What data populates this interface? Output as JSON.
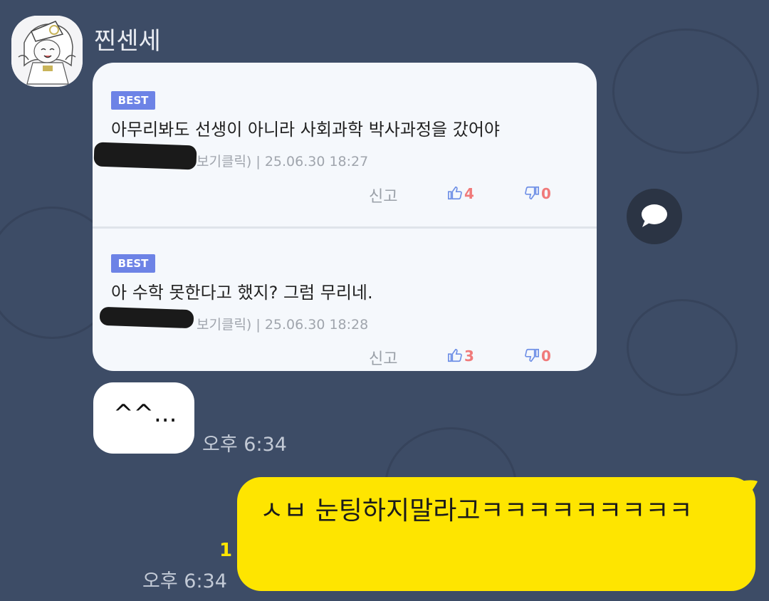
{
  "chat": {
    "sender_name": "찐센세",
    "comment_card": {
      "comments": [
        {
          "badge": "BEST",
          "text": "아무리봐도 선생이 아니라 사회과학 박사과정을 갔어야",
          "meta_visible": "보기클릭) | 25.06.30 18:27",
          "report_label": "신고",
          "likes": "4",
          "dislikes": "0"
        },
        {
          "badge": "BEST",
          "text": "아 수학 못한다고 했지? 그럼 무리네.",
          "meta_visible": "보기클릭) | 25.06.30 18:28",
          "report_label": "신고",
          "likes": "3",
          "dislikes": "0"
        }
      ]
    },
    "received_message": {
      "text": "^^...",
      "time": "오후 6:34"
    },
    "sent_message": {
      "text": "ㅅㅂ 눈팅하지말라고ㅋㅋㅋㅋㅋㅋㅋㅋㅋ",
      "time": "오후 6:34",
      "unread_count": "1"
    }
  },
  "colors": {
    "background": "#3d4c66",
    "sent_bubble": "#fee500",
    "badge": "#6d83e6",
    "vote_count": "#f07a7a"
  },
  "icons": [
    "avatar-image",
    "thumbs-up-icon",
    "thumbs-down-icon",
    "share-chat-icon"
  ]
}
